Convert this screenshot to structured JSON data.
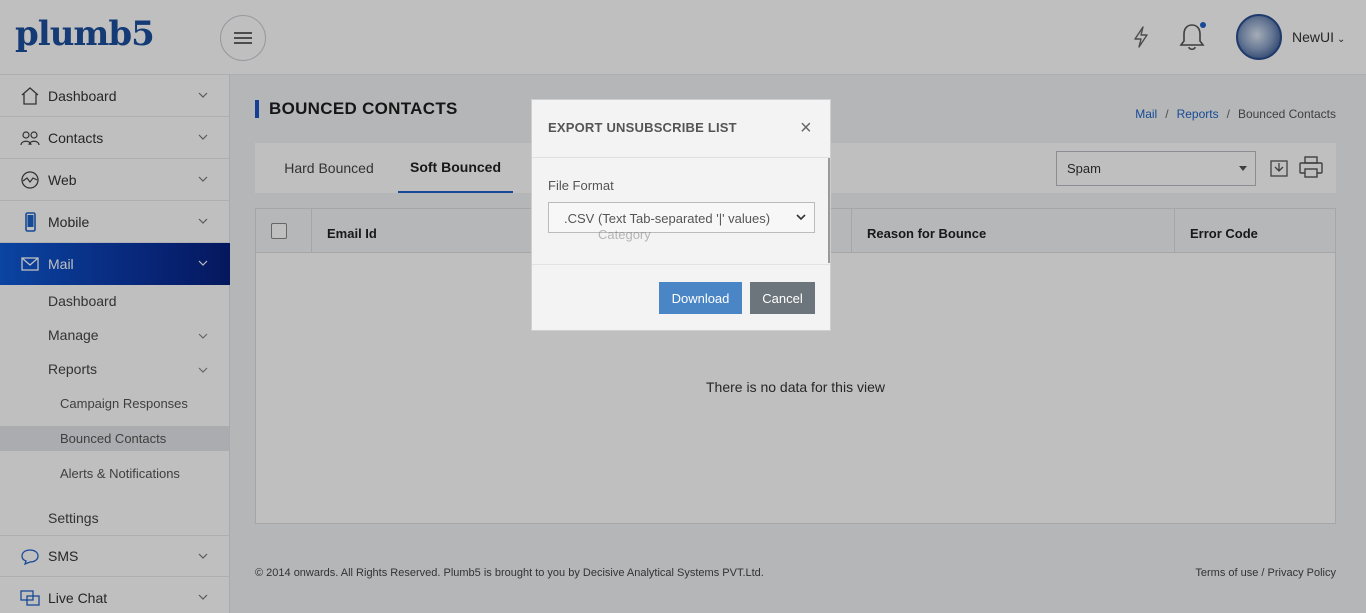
{
  "header": {
    "logo": "plumb5",
    "username": "NewUI",
    "icons": {
      "menu": "hamburger-icon",
      "quick": "bolt-icon",
      "notify": "bell-icon",
      "profile": "avatar"
    }
  },
  "sidebar": {
    "items": [
      {
        "label": "Dashboard",
        "icon": "home-icon"
      },
      {
        "label": "Contacts",
        "icon": "contacts-icon"
      },
      {
        "label": "Web",
        "icon": "web-icon"
      },
      {
        "label": "Mobile",
        "icon": "mobile-icon"
      },
      {
        "label": "Mail",
        "icon": "mail-icon",
        "active": true
      }
    ],
    "mail_sub": {
      "dashboard": "Dashboard",
      "manage": "Manage",
      "reports": "Reports",
      "reports_sub": [
        "Campaign Responses",
        "Bounced Contacts",
        "Alerts & Notifications"
      ],
      "settings": "Settings"
    },
    "items_after": [
      {
        "label": "SMS",
        "icon": "sms-icon"
      },
      {
        "label": "Live Chat",
        "icon": "chat-icon"
      }
    ],
    "active_color": "#0f3fb8"
  },
  "page": {
    "title": "BOUNCED CONTACTS",
    "breadcrumb": {
      "mail": "Mail",
      "reports": "Reports",
      "current": "Bounced Contacts",
      "sep": "/"
    },
    "tabs": [
      "Hard Bounced",
      "Soft Bounced"
    ],
    "active_tab": "Soft Bounced",
    "filter_value": "Spam",
    "table": {
      "columns": [
        "Email Id",
        "Category",
        "Reason for Bounce",
        "Error Code"
      ],
      "empty_text": "There is no data for this view"
    },
    "footer": {
      "copyright": "© 2014 onwards. All Rights Reserved. Plumb5 is brought to you by Decisive Analytical Systems PVT.Ltd.",
      "terms": "Terms of use",
      "sep": " / ",
      "privacy": "Privacy Policy"
    }
  },
  "modal": {
    "title": "EXPORT UNSUBSCRIBE LIST",
    "close": "×",
    "file_format_label": "File Format",
    "file_format_value": ".CSV  (Text Tab-separated '|' values)",
    "download_label": "Download",
    "cancel_label": "Cancel",
    "colors": {
      "download": "#4a86c5",
      "cancel": "#6d757c"
    }
  }
}
